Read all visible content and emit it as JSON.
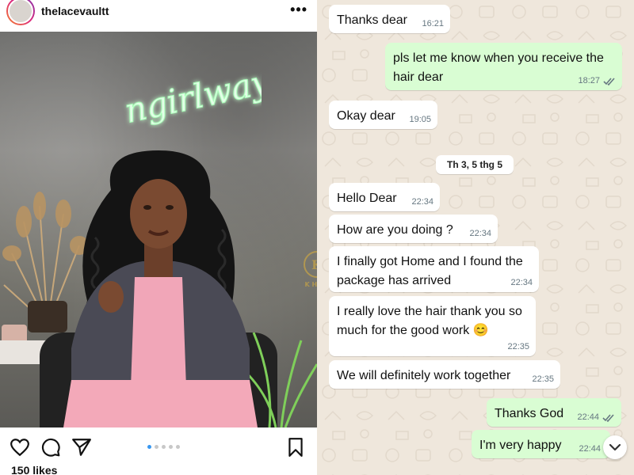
{
  "instagram": {
    "username": "thelacevaultt",
    "more_icon": "more-horizontal-icon",
    "likes": "150 likes",
    "carousel": {
      "total": 5,
      "active_index": 0
    },
    "neon_sign_text": "ngirlway",
    "watermark_text": "K HAIR"
  },
  "whatsapp": {
    "date_chip": "Th 3, 5 thg 5",
    "messages": [
      {
        "dir": "in",
        "text": "Thanks dear",
        "time": "16:21"
      },
      {
        "dir": "out",
        "text": "pls let me know when you receive the\nhair dear",
        "time": "18:27",
        "read": true
      },
      {
        "dir": "in",
        "text": "Okay dear",
        "time": "19:05"
      },
      {
        "dir": "in",
        "text": "Hello Dear",
        "time": "22:34"
      },
      {
        "dir": "in",
        "text": "How are you doing ?",
        "time": "22:34"
      },
      {
        "dir": "in",
        "text": "I finally got Home and I found the\npackage has arrived",
        "time": "22:34"
      },
      {
        "dir": "in",
        "text": "I really love the hair thank you so\nmuch for the good work 😊",
        "time": "22:35"
      },
      {
        "dir": "in",
        "text": "We will definitely work together",
        "time": "22:35"
      },
      {
        "dir": "out",
        "text": "Thanks God",
        "time": "22:44",
        "read": true
      },
      {
        "dir": "out",
        "text": "I'm very happy",
        "time": "22:44",
        "read": false
      }
    ],
    "colors": {
      "incoming": "#ffffff",
      "outgoing": "#d9fdd3",
      "background": "#efe7dc",
      "tick_read": "#53bdeb"
    }
  }
}
